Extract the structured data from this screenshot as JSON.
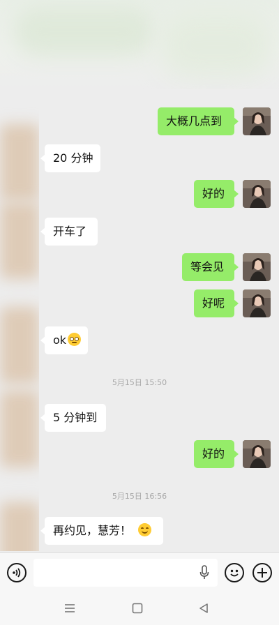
{
  "chat": {
    "messages": [
      {
        "from": "me",
        "text": "大概几点到"
      },
      {
        "from": "them",
        "text": "20 分钟"
      },
      {
        "from": "me",
        "text": "好的"
      },
      {
        "from": "them",
        "text": "开车了"
      },
      {
        "from": "me",
        "text": "等会见"
      },
      {
        "from": "me",
        "text": "好呢"
      },
      {
        "from": "them",
        "text": "ok",
        "emoji": "flushed-face-icon"
      },
      {
        "from": "them",
        "text": "5 分钟到"
      },
      {
        "from": "me",
        "text": "好的"
      },
      {
        "from": "them",
        "text": "再约见，慧芳！",
        "emoji": "smiling-face-icon"
      }
    ],
    "timestamps": [
      "5月15日 15:50",
      "5月15日 16:56"
    ]
  },
  "input_bar": {
    "placeholder": "",
    "icons": [
      "voice-icon",
      "microphone-icon",
      "emoji-icon",
      "plus-icon"
    ]
  },
  "nav_bar": {
    "icons": [
      "menu-icon",
      "home-icon",
      "back-icon"
    ]
  },
  "colors": {
    "background": "#ededed",
    "outgoing_bubble": "#95ec69",
    "incoming_bubble": "#ffffff",
    "input_bar": "#f7f7f7"
  }
}
